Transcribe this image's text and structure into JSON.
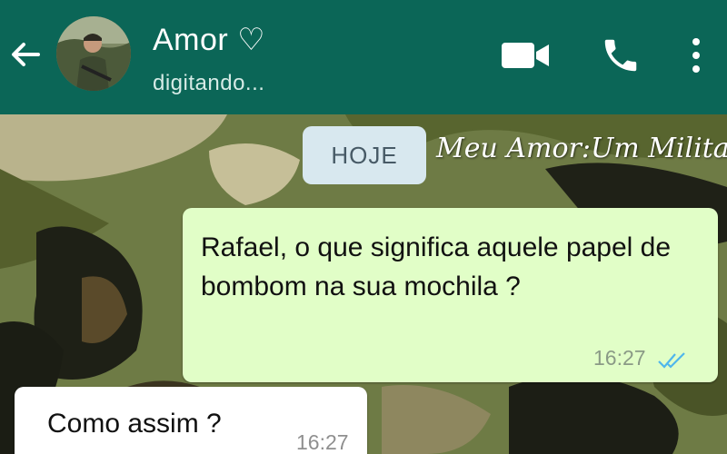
{
  "header": {
    "contact_name": "Amor ♡",
    "status": "digitando..."
  },
  "icons": {
    "back": "arrow-left-icon",
    "video": "video-camera-icon",
    "call": "phone-icon",
    "menu": "more-vertical-icon"
  },
  "chat": {
    "date_label": "HOJE",
    "watermark": "Meu Amor:Um Militar",
    "messages": [
      {
        "direction": "outgoing",
        "text": "Rafael, o que significa aquele papel de bombom na sua mochila ?",
        "time": "16:27",
        "read": true
      },
      {
        "direction": "incoming",
        "text": "Como assim ?",
        "time": "16:27"
      }
    ]
  },
  "colors": {
    "header": "#0b6657",
    "outgoing_bubble": "#e1fec7",
    "incoming_bubble": "#ffffff",
    "read_ticks": "#4fb6ec"
  }
}
